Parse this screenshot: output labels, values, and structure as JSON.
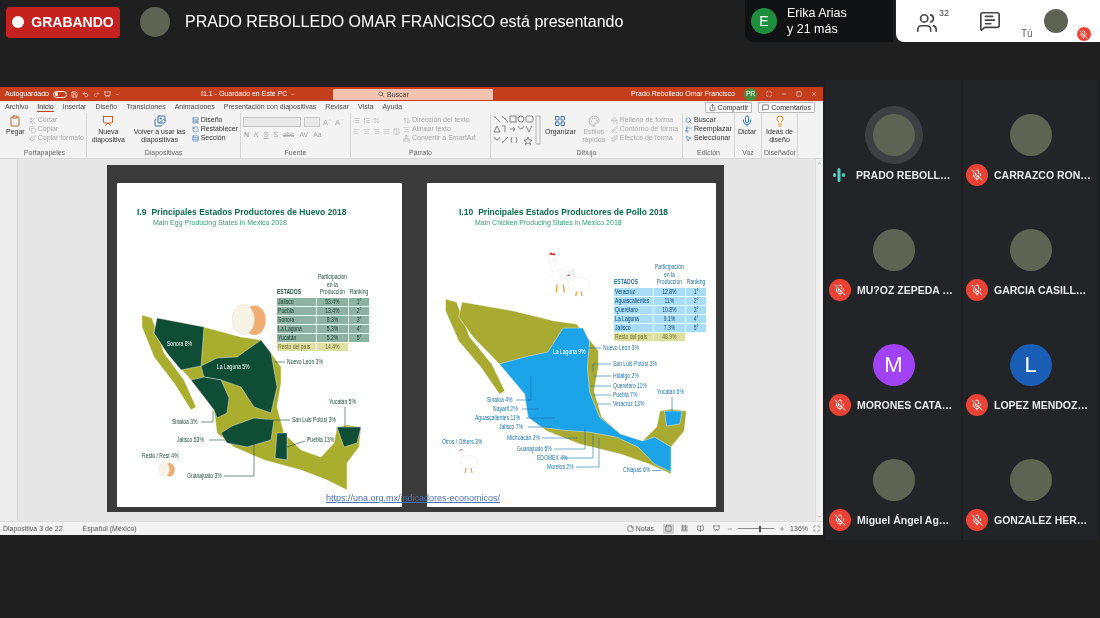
{
  "top_bar": {
    "recording": {
      "label": "GRABANDO"
    },
    "presenter": {
      "avatar": {
        "kind": "photo"
      },
      "text": "PRADO REBOLLEDO OMAR FRANCISCO está presentando"
    },
    "others": {
      "initial": "E",
      "name": "Erika Arias",
      "more": "y 21 más"
    },
    "people_count": "32",
    "self": {
      "label": "Tú",
      "avatar": {
        "kind": "photo"
      },
      "muted": true
    }
  },
  "presentation": {
    "title_bar": {
      "autosave": {
        "label": "Autoguardado",
        "on": false
      },
      "document": "I1.1 - Guardado en Este PC",
      "search": {
        "placeholder": "Buscar"
      },
      "user": {
        "name": "Prado Rebolledo Omar Francisco",
        "initials": "PR"
      }
    },
    "tabs": [
      {
        "label": "Archivo",
        "selected": false
      },
      {
        "label": "Inicio",
        "selected": true
      },
      {
        "label": "Insertar",
        "selected": false
      },
      {
        "label": "Diseño",
        "selected": false
      },
      {
        "label": "Transiciones",
        "selected": false
      },
      {
        "label": "Animaciones",
        "selected": false
      },
      {
        "label": "Presentación con diapositivas",
        "selected": false
      },
      {
        "label": "Revisar",
        "selected": false
      },
      {
        "label": "Vista",
        "selected": false
      },
      {
        "label": "Ayuda",
        "selected": false
      }
    ],
    "actions": [
      {
        "kind": "share",
        "label": "Compartir"
      },
      {
        "kind": "comments",
        "label": "Comentarios"
      }
    ],
    "ribbon": [
      {
        "label": "Portapapeles",
        "items": [
          {
            "kind": "large",
            "label": "Pegar",
            "disabled": false
          },
          {
            "kind": "stack",
            "items": [
              {
                "label": "Cortar",
                "disabled": true
              },
              {
                "label": "Copiar",
                "disabled": true
              },
              {
                "label": "Copiar formato",
                "disabled": true
              }
            ]
          }
        ]
      },
      {
        "label": "Diapositivas",
        "items": [
          {
            "kind": "large",
            "label": "Nueva diapositiva",
            "disabled": false
          },
          {
            "kind": "large",
            "label": "Volver a usar las diapositivas",
            "disabled": false
          },
          {
            "kind": "stack",
            "items": [
              {
                "label": "Diseño",
                "disabled": false
              },
              {
                "label": "Restablecer",
                "disabled": false
              },
              {
                "label": "Sección",
                "disabled": false
              }
            ]
          }
        ]
      },
      {
        "label": "Fuente",
        "items": [
          {
            "kind": "font",
            "disabled": true,
            "size_buttons": [
              "A",
              "A"
            ],
            "format_buttons": [
              "N",
              "K",
              "S",
              "S",
              "abc",
              "AV",
              "Aa"
            ]
          }
        ]
      },
      {
        "label": "Párrafo",
        "items": [
          {
            "kind": "paragraph",
            "disabled": true
          },
          {
            "kind": "stack",
            "items": [
              {
                "label": "Dirección del texto",
                "disabled": true
              },
              {
                "label": "Alinear texto",
                "disabled": true
              },
              {
                "label": "Convertir a SmartArt",
                "disabled": true
              }
            ]
          }
        ]
      },
      {
        "label": "Dibujo",
        "items": [
          {
            "kind": "shapes"
          },
          {
            "kind": "large",
            "label": "Organizar",
            "disabled": false
          },
          {
            "kind": "large",
            "label": "Estilos rápidos",
            "disabled": true
          },
          {
            "kind": "stack",
            "items": [
              {
                "label": "Relleno de forma",
                "disabled": true
              },
              {
                "label": "Contorno de forma",
                "disabled": true
              },
              {
                "label": "Efectos de forma",
                "disabled": true
              }
            ]
          }
        ]
      },
      {
        "label": "Edición",
        "items": [
          {
            "kind": "stack",
            "items": [
              {
                "label": "Buscar",
                "disabled": false
              },
              {
                "label": "Reemplazar",
                "disabled": false
              },
              {
                "label": "Seleccionar",
                "disabled": false
              }
            ]
          }
        ]
      },
      {
        "label": "Voz",
        "items": [
          {
            "kind": "large",
            "label": "Dictar",
            "disabled": false
          }
        ]
      },
      {
        "label": "Diseñador",
        "items": [
          {
            "kind": "large",
            "label": "Ideas de diseño",
            "disabled": false
          }
        ]
      }
    ],
    "slides": [
      {
        "kind": "egg",
        "number": "I.9",
        "title": "Principales Estados Productores de Huevo 2018",
        "subtitle": "Main Egg Producing States in Mexico 2018",
        "table": {
          "columns": [
            "ESTADOS",
            "Participación en la Producción",
            "Ranking"
          ],
          "rows": [
            {
              "kind": "state",
              "cells": [
                "Jalisco",
                "53.4%",
                "1°"
              ]
            },
            {
              "kind": "state",
              "cells": [
                "Puebla",
                "13.4%",
                "2°"
              ]
            },
            {
              "kind": "state",
              "cells": [
                "Sonora",
                "8.3%",
                "3°"
              ]
            },
            {
              "kind": "state",
              "cells": [
                "La Laguna",
                "5.3%",
                "4°"
              ]
            },
            {
              "kind": "state",
              "cells": [
                "Yucatán",
                "5.2%",
                "5°"
              ]
            },
            {
              "kind": "rest",
              "cells": [
                "Resto del país",
                "14.4%"
              ]
            }
          ]
        },
        "map_labels": [
          {
            "kind": "inside",
            "text": "Sonora 8%"
          },
          {
            "kind": "inside",
            "text": "La Laguna 5%"
          },
          {
            "kind": "callout",
            "text": "Nuevo León 3%"
          },
          {
            "kind": "callout",
            "text": "Sinaloa 3%"
          },
          {
            "kind": "callout",
            "text": "Jalisco 53%"
          },
          {
            "kind": "callout",
            "text": "San Luis Potosí 3%"
          },
          {
            "kind": "callout",
            "text": "Yucatán 5%"
          },
          {
            "kind": "callout",
            "text": "Puebla 13%"
          },
          {
            "kind": "callout",
            "text": "Resto / Rest 4%"
          },
          {
            "kind": "callout",
            "text": "Guanajuato 3%"
          }
        ]
      },
      {
        "kind": "chicken",
        "number": "I.10",
        "title": "Principales Estados Productores de Pollo 2018",
        "subtitle": "Main Chicken Producing States in Mexico 2018",
        "table": {
          "columns": [
            "ESTADOS",
            "Participación en la Producción",
            "Ranking"
          ],
          "rows": [
            {
              "kind": "state",
              "cells": [
                "Veracruz",
                "12.8%",
                "1°"
              ]
            },
            {
              "kind": "state",
              "cells": [
                "Aguascalientes",
                "11%",
                "2°"
              ]
            },
            {
              "kind": "state",
              "cells": [
                "Querétaro",
                "10.8%",
                "3°"
              ]
            },
            {
              "kind": "state",
              "cells": [
                "La Laguna",
                "9.1%",
                "4°"
              ]
            },
            {
              "kind": "state",
              "cells": [
                "Jalisco",
                "7.3%",
                "5°"
              ]
            },
            {
              "kind": "rest",
              "cells": [
                "Resto del país",
                "48.9%"
              ]
            }
          ]
        },
        "map_labels": [
          {
            "kind": "inside",
            "text": "La Laguna 9%"
          },
          {
            "kind": "callout",
            "text": "Nuevo León 3%"
          },
          {
            "kind": "callout",
            "text": "San Luis Potosí 3%"
          },
          {
            "kind": "callout",
            "text": "Yucatán 6%"
          },
          {
            "kind": "callout",
            "text": "Sinaloa 4%"
          },
          {
            "kind": "callout",
            "text": "Hidalgo 2%"
          },
          {
            "kind": "callout",
            "text": "Nayarit 2%"
          },
          {
            "kind": "callout",
            "text": "Querétaro 11%"
          },
          {
            "kind": "callout",
            "text": "Aguascalientes 11%"
          },
          {
            "kind": "callout",
            "text": "Puebla 7%"
          },
          {
            "kind": "callout",
            "text": "Jalisco 7%"
          },
          {
            "kind": "callout",
            "text": "Veracruz 13%"
          },
          {
            "kind": "callout",
            "text": "Otros / Others 3%"
          },
          {
            "kind": "callout",
            "text": "Michoacán 2%"
          },
          {
            "kind": "callout",
            "text": "Guanajuato 5%"
          },
          {
            "kind": "callout",
            "text": "EDOMEX 4%"
          },
          {
            "kind": "callout",
            "text": "Morelos 2%"
          },
          {
            "kind": "callout",
            "text": "Chiapas 6%"
          }
        ]
      }
    ],
    "link": "https://una.org.mx/indicadores-economicos/",
    "status_bar": {
      "slide": "Diapositiva 3 de 22",
      "language": "Español (México)",
      "notes": "Notas",
      "views": [
        {
          "kind": "normal",
          "selected": true
        },
        {
          "kind": "sorter",
          "selected": false
        },
        {
          "kind": "reading",
          "selected": false
        },
        {
          "kind": "slideshow",
          "selected": false
        }
      ],
      "zoom": {
        "label": "136%",
        "level": 0.6
      }
    }
  },
  "participants": [
    {
      "name": "PRADO REBOLL…",
      "avatar": {
        "kind": "photo"
      },
      "muted": false,
      "speaking": true
    },
    {
      "name": "CARRAZCO RON…",
      "avatar": {
        "kind": "photo"
      },
      "muted": true,
      "speaking": false
    },
    {
      "name": "MU?OZ ZEPEDA …",
      "avatar": {
        "kind": "photo"
      },
      "muted": true,
      "speaking": false
    },
    {
      "name": "GARCIA CASILL…",
      "avatar": {
        "kind": "photo"
      },
      "muted": true,
      "speaking": false
    },
    {
      "name": "MORONES CATA…",
      "avatar": {
        "kind": "letter",
        "letter": "M",
        "color": "#a142f4"
      },
      "muted": true,
      "speaking": false
    },
    {
      "name": "LOPEZ MENDOZ…",
      "avatar": {
        "kind": "letter",
        "letter": "L",
        "color": "#1a5db5"
      },
      "muted": true,
      "speaking": false
    },
    {
      "name": "Miguel Ángel Ag…",
      "avatar": {
        "kind": "photo"
      },
      "muted": true,
      "speaking": false
    },
    {
      "name": "GONZALEZ HER…",
      "avatar": {
        "kind": "photo"
      },
      "muted": true,
      "speaking": false
    }
  ]
}
